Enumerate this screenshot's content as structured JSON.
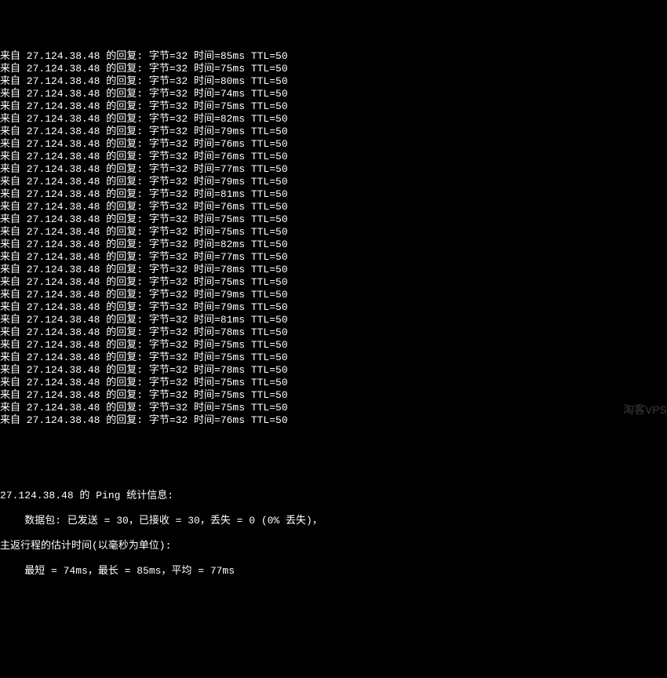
{
  "ip": "27.124.38.48",
  "bytes_label": "字节=32",
  "time_label_prefix": "时间=",
  "ttl_label": "TTL=50",
  "reply_prefix": "来自",
  "reply_suffix": "的回复:",
  "ping_lines": [
    {
      "time": "85ms"
    },
    {
      "time": "75ms"
    },
    {
      "time": "80ms"
    },
    {
      "time": "74ms"
    },
    {
      "time": "75ms"
    },
    {
      "time": "82ms"
    },
    {
      "time": "79ms"
    },
    {
      "time": "76ms"
    },
    {
      "time": "76ms"
    },
    {
      "time": "77ms"
    },
    {
      "time": "79ms"
    },
    {
      "time": "81ms"
    },
    {
      "time": "76ms"
    },
    {
      "time": "75ms"
    },
    {
      "time": "75ms"
    },
    {
      "time": "82ms"
    },
    {
      "time": "77ms"
    },
    {
      "time": "78ms"
    },
    {
      "time": "75ms"
    },
    {
      "time": "79ms"
    },
    {
      "time": "79ms"
    },
    {
      "time": "81ms"
    },
    {
      "time": "78ms"
    },
    {
      "time": "75ms"
    },
    {
      "time": "75ms"
    },
    {
      "time": "78ms"
    },
    {
      "time": "75ms"
    },
    {
      "time": "75ms"
    },
    {
      "time": "75ms"
    },
    {
      "time": "76ms"
    }
  ],
  "stats": {
    "header": "27.124.38.48 的 Ping 统计信息:",
    "packets": "    数据包: 已发送 = 30，已接收 = 30，丢失 = 0 (0% 丢失)，",
    "rtt_header": "主返行程的估计时间(以毫秒为单位):",
    "rtt_values": "    最短 = 74ms，最长 = 85ms，平均 = 77ms"
  },
  "watermark": "淘客VPS"
}
